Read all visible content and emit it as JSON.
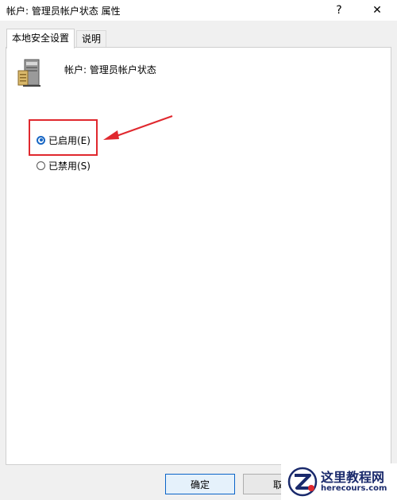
{
  "window": {
    "title": "帐户: 管理员帐户状态 属性",
    "help_glyph": "?",
    "close_glyph": "✕"
  },
  "tabs": [
    {
      "label": "本地安全设置",
      "active": true
    },
    {
      "label": "说明",
      "active": false
    }
  ],
  "policy": {
    "name": "帐户: 管理员帐户状态",
    "icon": "server-icon"
  },
  "options": [
    {
      "label": "已启用(E)",
      "checked": true
    },
    {
      "label": "已禁用(S)",
      "checked": false
    }
  ],
  "buttons": {
    "ok": "确定",
    "cancel": "取"
  },
  "annotation": {
    "color": "#e0282e"
  },
  "watermark": {
    "title": "这里教程网",
    "url": "herecours.com"
  }
}
